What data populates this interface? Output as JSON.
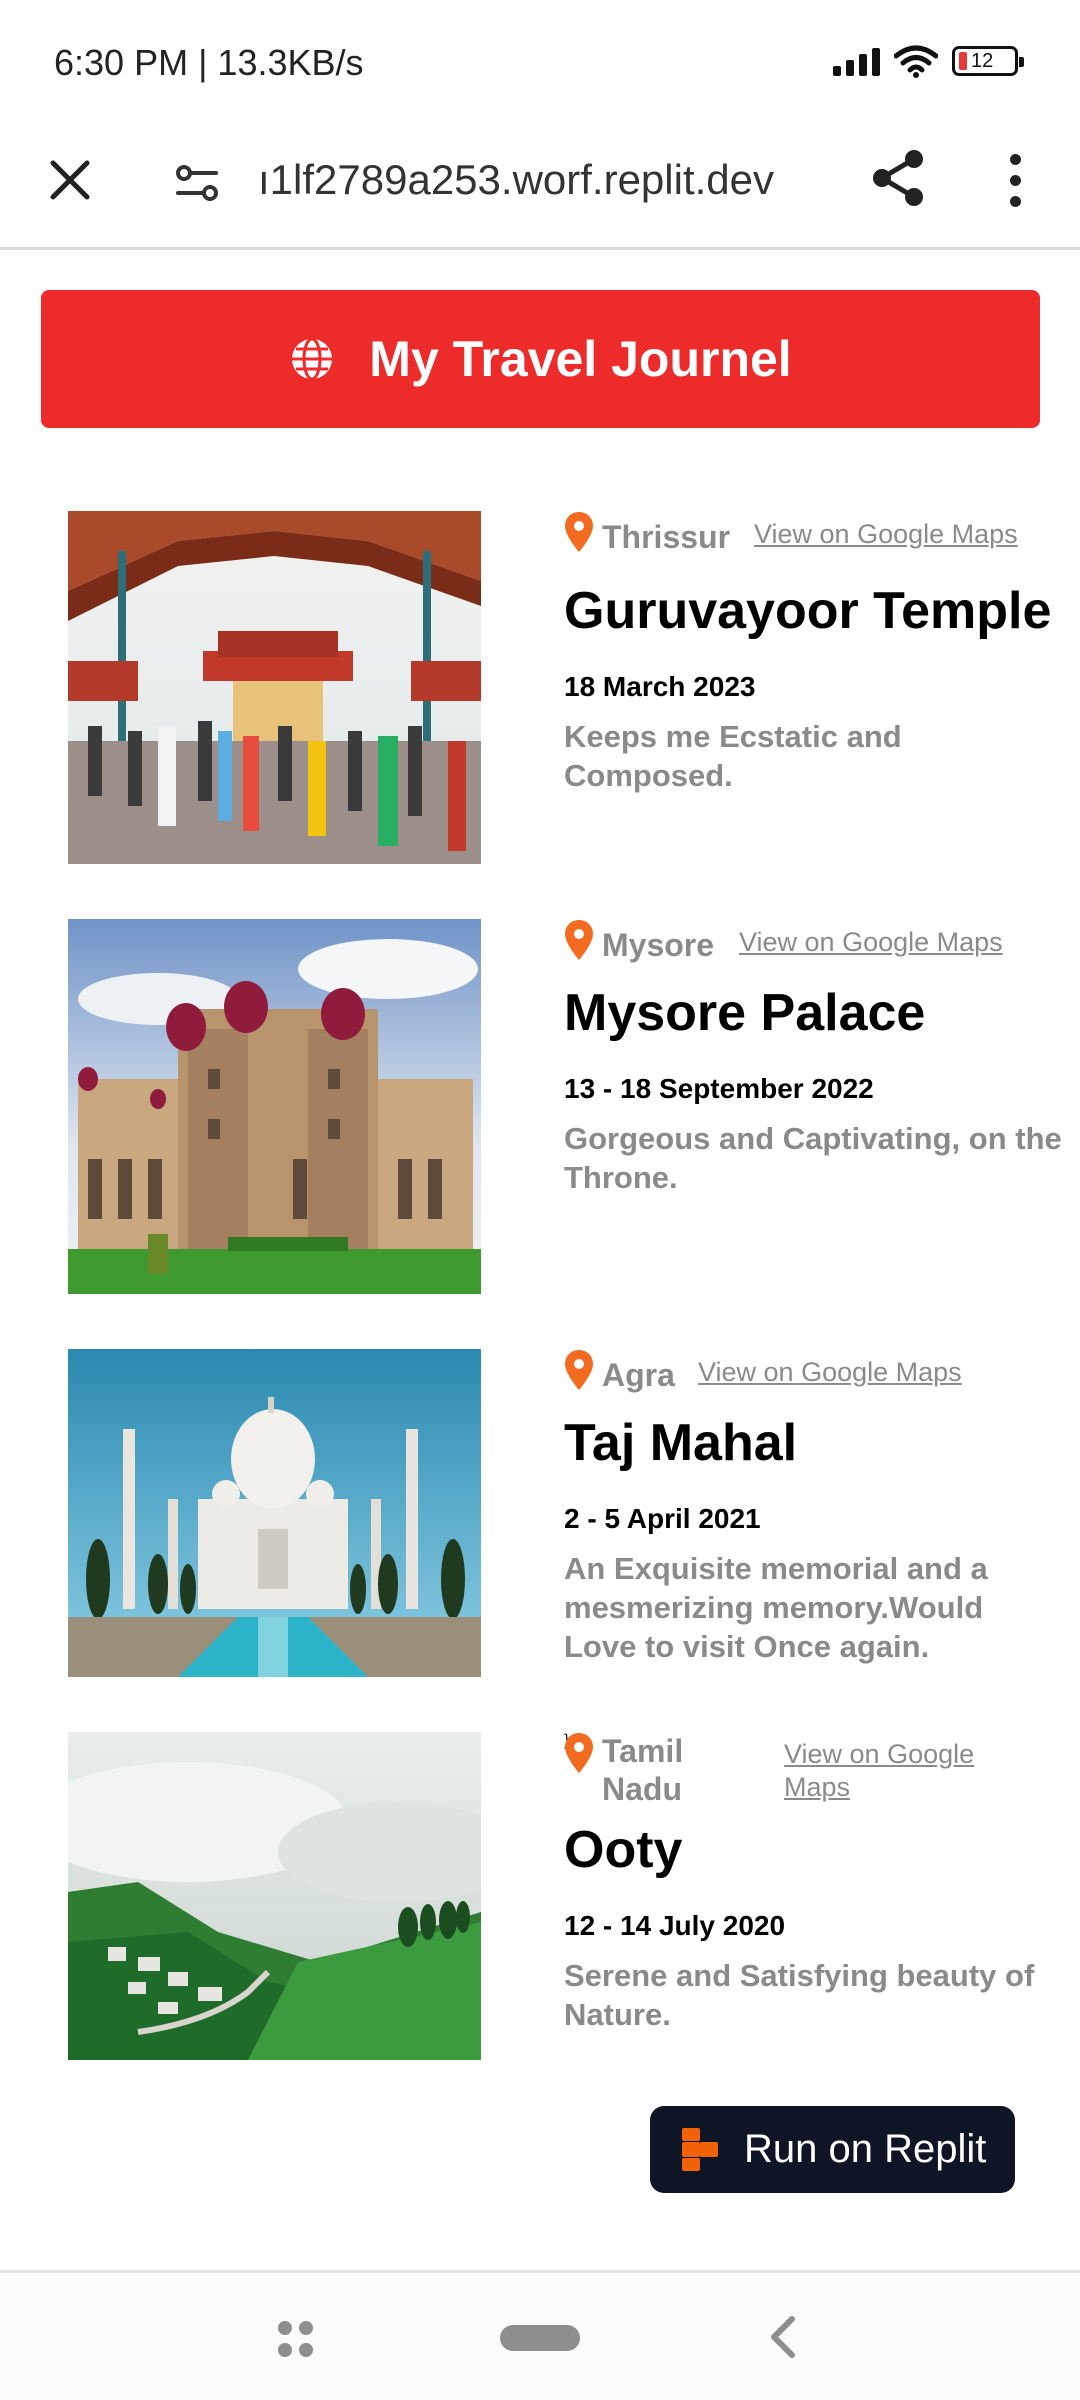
{
  "status_bar": {
    "time": "6:30 PM | 13.3KB/s",
    "battery": "12",
    "colors": {
      "battery_low": "#e53935"
    }
  },
  "browser": {
    "url": "ı1lf2789a253.worf.replit.dev",
    "icons": [
      "close-icon",
      "page-info-icon",
      "share-icon",
      "more-vert-icon"
    ]
  },
  "header": {
    "title": "My Travel Journel",
    "icon": "globe-icon",
    "colors": {
      "background": "#ee2b2b",
      "text": "#ffffff"
    }
  },
  "entries": [
    {
      "location": "Thrissur",
      "maps_link": "View on Google Maps",
      "title": "Guruvayoor Temple",
      "date": "18 March 2023",
      "description": "Keeps me Ecstatic and Composed."
    },
    {
      "location": "Mysore",
      "maps_link": "View on Google Maps",
      "title": "Mysore Palace",
      "date": "13 - 18 September 2022",
      "description": "Gorgeous and Captivating, on the Throne."
    },
    {
      "location": "Agra",
      "maps_link": "View on Google Maps",
      "title": "Taj Mahal",
      "date": "2 - 5 April 2021",
      "description": "An Exquisite memorial and a mesmerizing memory.Would Love to visit Once again."
    },
    {
      "location": "Tamil Nadu",
      "maps_link": "View on Google Maps",
      "title": "Ooty",
      "date": "12 - 14 July 2020",
      "description": "Serene and Satisfying beauty of Nature."
    }
  ],
  "replit_button": {
    "label": "Run on Replit",
    "colors": {
      "background": "#0e1525",
      "logo": "#f26207"
    }
  },
  "accent_colors": {
    "pin": "#f26b21",
    "muted_text": "#8a8a8a"
  }
}
